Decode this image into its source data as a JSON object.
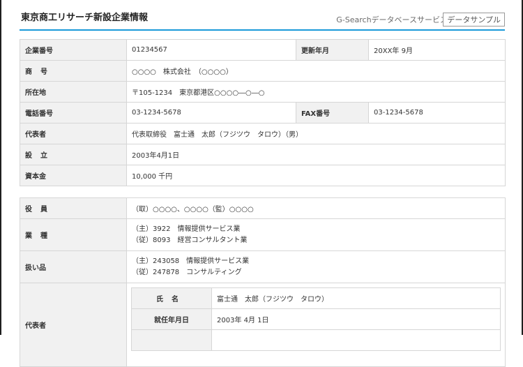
{
  "header": {
    "title": "東京商工リサーチ新設企業情報",
    "service": "G-Searchデータベースサービス",
    "sample_button": "データサンプル"
  },
  "company": {
    "number_label": "企業番号",
    "number": "01234567",
    "updated_label": "更新年月",
    "updated": "20XX年 9月",
    "name_label": "商号",
    "name": "○○○○　株式会社　（○○○○）",
    "address_label": "所在地",
    "address": "〒105-1234　東京都港区○○○○―○―○",
    "phone_label": "電話番号",
    "phone": "03-1234-5678",
    "fax_label": "FAX番号",
    "fax": "03-1234-5678",
    "representative_label": "代表者",
    "representative": "代表取締役　富士通　太郎（フジツウ　タロウ）（男）",
    "established_label": "設立",
    "established": "2003年4月1日",
    "capital_label": "資本金",
    "capital": "10,000 千円"
  },
  "details": {
    "officers_label": "役員",
    "officers": "（取）○○○○、○○○○（監）○○○○",
    "industry_label": "業種",
    "industry": [
      "（主）3922　情報提供サービス業",
      "（従）8093　経営コンサルタント業"
    ],
    "products_label": "扱い品",
    "products": [
      "（主）243058　情報提供サービス業",
      "（従）247878　コンサルティング"
    ],
    "rep_label": "代表者",
    "rep_rows": [
      {
        "label": "氏名",
        "value": "富士通　太郎（フジツウ　タロウ）"
      },
      {
        "label": "就任年月日",
        "value": "2003年 4月 1日"
      }
    ]
  }
}
